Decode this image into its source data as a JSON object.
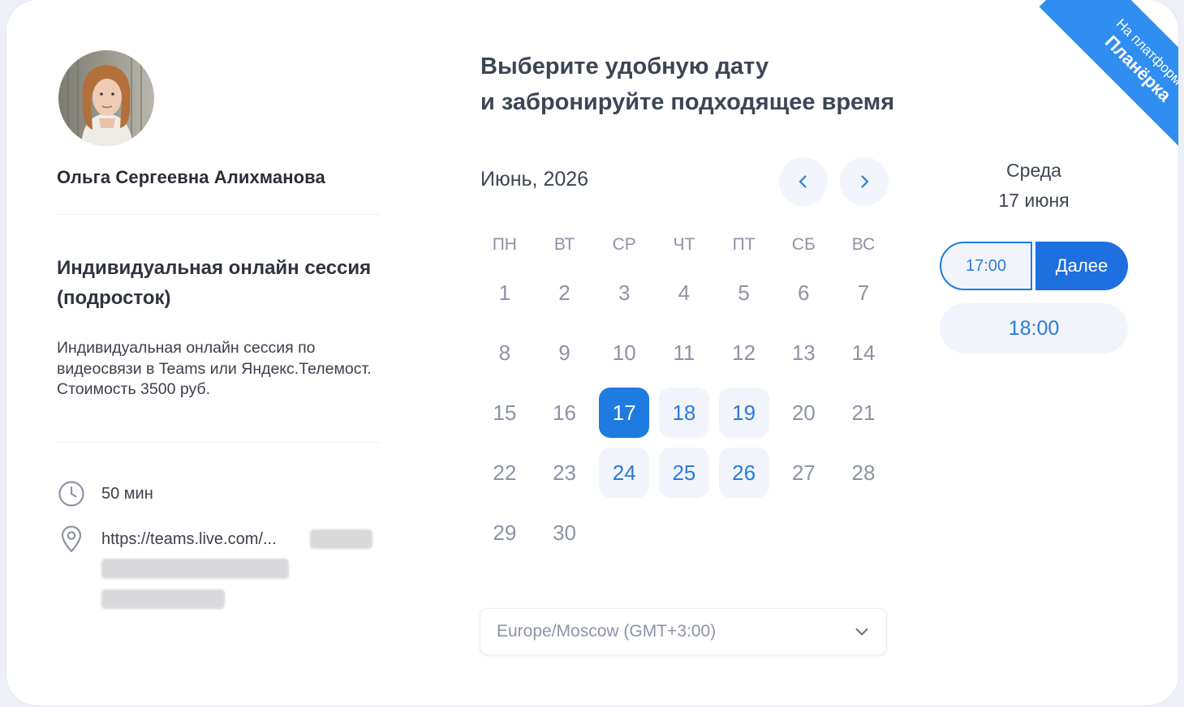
{
  "host": {
    "name": "Ольга Сергеевна Алихманова"
  },
  "event": {
    "title": "Индивидуальная онлайн сессия (подросток)",
    "description": "Индивидуальная онлайн сессия по видеосвязи в Teams или Яндекс.Телемост. Стоимость 3500 руб.",
    "duration": "50 мин",
    "location": "https://teams.live.com/..."
  },
  "booking": {
    "heading_line1": "Выберите удобную дату",
    "heading_line2": "и забронируйте подходящее время"
  },
  "calendar": {
    "month_label": "Июнь, 2026",
    "weekdays": [
      "ПН",
      "ВТ",
      "СР",
      "ЧТ",
      "ПТ",
      "СБ",
      "ВС"
    ],
    "weeks": [
      [
        "1",
        "2",
        "3",
        "4",
        "5",
        "6",
        "7"
      ],
      [
        "8",
        "9",
        "10",
        "11",
        "12",
        "13",
        "14"
      ],
      [
        "15",
        "16",
        "17",
        "18",
        "19",
        "20",
        "21"
      ],
      [
        "22",
        "23",
        "24",
        "25",
        "26",
        "27",
        "28"
      ],
      [
        "29",
        "30",
        "",
        "",
        "",
        "",
        ""
      ]
    ],
    "selected_day": "17",
    "available_days": [
      "17",
      "18",
      "19",
      "24",
      "25",
      "26"
    ],
    "prev_icon": "chevron-left-icon",
    "next_icon": "chevron-right-icon"
  },
  "timezone": {
    "value": "Europe/Moscow (GMT+3:00)",
    "icon": "chevron-down-icon"
  },
  "slots": {
    "weekday": "Среда",
    "date": "17 июня",
    "selected_time": "17:00",
    "next_label": "Далее",
    "other_times": [
      "18:00"
    ]
  },
  "ribbon": {
    "line1": "На платформе",
    "line2": "Планёрка"
  },
  "colors": {
    "accent": "#1e7be0",
    "available_bg": "#f1f5fb",
    "ribbon": "#2f8ef0",
    "muted_text": "#8d93a5"
  }
}
